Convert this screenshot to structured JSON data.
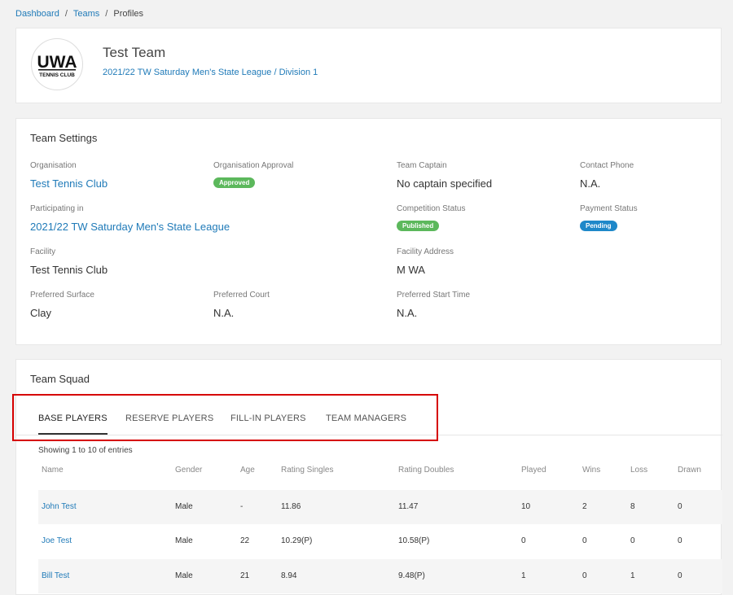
{
  "breadcrumb": {
    "items": [
      "Dashboard",
      "Teams",
      "Profiles"
    ],
    "separator": "/"
  },
  "profile": {
    "logo_text_top": "UWA",
    "logo_text_bottom": "TENNIS CLUB",
    "team_name": "Test Team",
    "competition": "2021/22 TW Saturday Men's State League",
    "slash": "/",
    "division": "Division 1"
  },
  "settings": {
    "title": "Team Settings",
    "organisation": {
      "label": "Organisation",
      "value": "Test Tennis Club"
    },
    "organisation_approval": {
      "label": "Organisation Approval",
      "badge": "Approved"
    },
    "team_captain": {
      "label": "Team Captain",
      "value": "No captain specified"
    },
    "contact_phone": {
      "label": "Contact Phone",
      "value": "N.A."
    },
    "participating_in": {
      "label": "Participating in",
      "value": "2021/22 TW Saturday Men's State League"
    },
    "competition_status": {
      "label": "Competition Status",
      "badge": "Published"
    },
    "payment_status": {
      "label": "Payment Status",
      "badge": "Pending"
    },
    "facility": {
      "label": "Facility",
      "value": "Test Tennis Club"
    },
    "facility_address": {
      "label": "Facility Address",
      "value": "M WA"
    },
    "preferred_surface": {
      "label": "Preferred Surface",
      "value": "Clay"
    },
    "preferred_court": {
      "label": "Preferred Court",
      "value": "N.A."
    },
    "preferred_start_time": {
      "label": "Preferred Start Time",
      "value": "N.A."
    }
  },
  "squad": {
    "title": "Team Squad",
    "tabs": [
      "BASE PLAYERS",
      "RESERVE PLAYERS",
      "FILL-IN PLAYERS",
      "TEAM MANAGERS"
    ],
    "active_tab": 0,
    "showing": "Showing 1 to 10 of entries",
    "columns": [
      "Name",
      "Gender",
      "Age",
      "Rating Singles",
      "Rating Doubles",
      "Played",
      "Wins",
      "Loss",
      "Drawn"
    ],
    "rows": [
      [
        "John Test",
        "Male",
        "-",
        "11.86",
        "11.47",
        "10",
        "2",
        "8",
        "0"
      ],
      [
        "Joe Test",
        "Male",
        "22",
        "10.29(P)",
        "10.58(P)",
        "0",
        "0",
        "0",
        "0"
      ],
      [
        "Bill Test",
        "Male",
        "21",
        "8.94",
        "9.48(P)",
        "1",
        "0",
        "1",
        "0"
      ]
    ]
  },
  "colors": {
    "link": "#1f7ab8",
    "approved": "#5cb85c",
    "published": "#5cb85c",
    "pending": "#1e88c9",
    "highlight": "#d60000"
  }
}
